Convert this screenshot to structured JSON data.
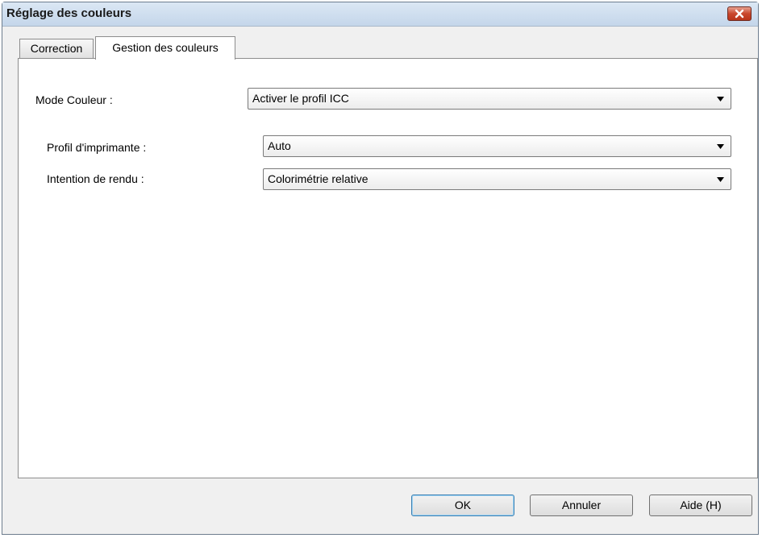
{
  "window": {
    "title": "Réglage des couleurs"
  },
  "tabs": [
    {
      "label": "Correction",
      "active": false
    },
    {
      "label": "Gestion des couleurs",
      "active": true
    }
  ],
  "form": {
    "mode_couleur": {
      "label": "Mode Couleur :",
      "value": "Activer le profil ICC"
    },
    "profil_imprimante": {
      "label": "Profil d'imprimante :",
      "value": "Auto"
    },
    "intention_rendu": {
      "label": "Intention de rendu :",
      "value": "Colorimétrie relative"
    }
  },
  "buttons": {
    "ok": "OK",
    "cancel": "Annuler",
    "help": "Aide (H)"
  },
  "colors": {
    "close_button": "#c9462c",
    "default_button_border": "#3c7fb1"
  }
}
